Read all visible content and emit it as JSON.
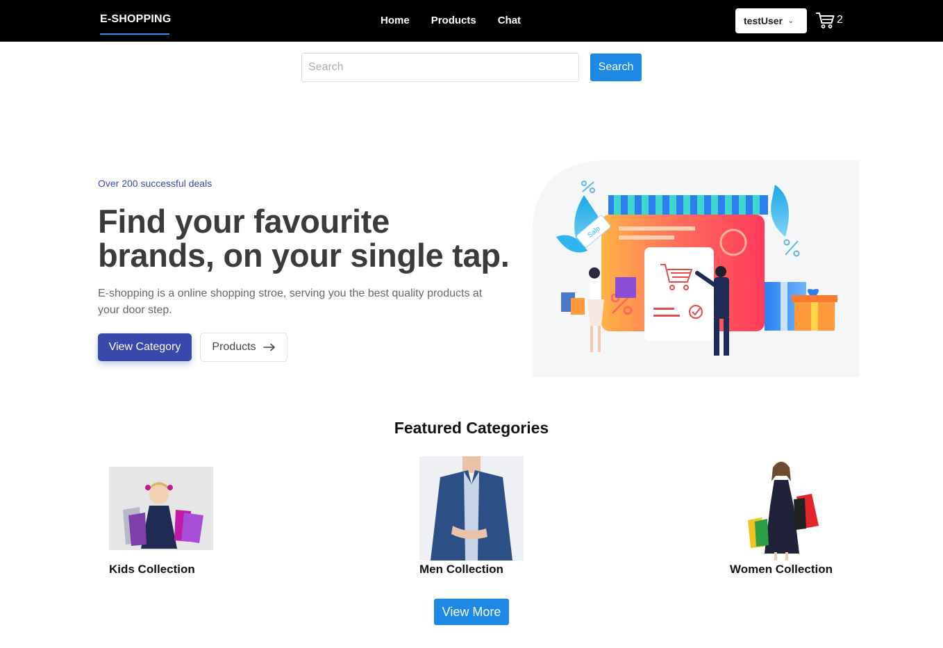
{
  "header": {
    "brand": "E-SHOPPING",
    "nav": [
      "Home",
      "Products",
      "Chat"
    ],
    "user": "testUser",
    "cart_count": "2"
  },
  "search": {
    "placeholder": "Search",
    "button": "Search"
  },
  "hero": {
    "kicker": "Over 200 successful deals",
    "title_line1": "Find your favourite",
    "title_line2": "brands, on your single tap.",
    "description": "E-shopping is a online shopping stroe, serving you the best quality products at your door step.",
    "primary_button": "View Category",
    "secondary_button": "Products",
    "illustration_sale_tag": "Sale"
  },
  "categories": {
    "title": "Featured Categories",
    "items": [
      {
        "label": "Kids Collection"
      },
      {
        "label": "Men Collection"
      },
      {
        "label": "Women Collection"
      }
    ],
    "view_more": "View More"
  },
  "colors": {
    "navbar": "#000000",
    "primary_blue": "#1e88e5",
    "indigo": "#3949ab"
  },
  "icons": {
    "cart": "cart-icon",
    "user_dropdown": "chevron-down-icon",
    "arrow": "arrow-right-icon"
  }
}
